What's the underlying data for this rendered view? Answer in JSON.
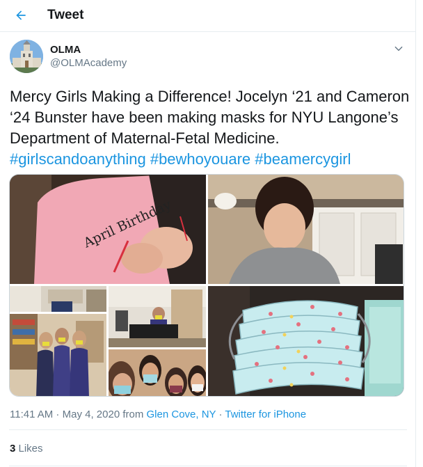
{
  "header": {
    "title": "Tweet",
    "back_icon": "arrow-left-icon"
  },
  "author": {
    "name": "OLMA",
    "handle": "@OLMAcademy"
  },
  "tweet": {
    "text": "Mercy Girls Making a Difference! Jocelyn ‘21 and Cameron ‘24 Bunster have been making masks for NYU Langone’s Department of Maternal-Fetal Medicine. ",
    "hashtags": [
      "#girlscandoanything",
      "#bewhoyouare",
      "#beamercygirl"
    ]
  },
  "photo_text": {
    "shirt": "April Birthday"
  },
  "meta": {
    "time": "11:41 AM",
    "dot1": " · ",
    "date": "May 4, 2020",
    "from": " from ",
    "location": "Glen Cove, NY",
    "dot2": " · ",
    "source": "Twitter for iPhone"
  },
  "stats": {
    "likes_count": "3",
    "likes_label": " Likes"
  },
  "colors": {
    "accent": "#1b95e0",
    "secondary_text": "#657786",
    "border": "#e6ecf0"
  }
}
